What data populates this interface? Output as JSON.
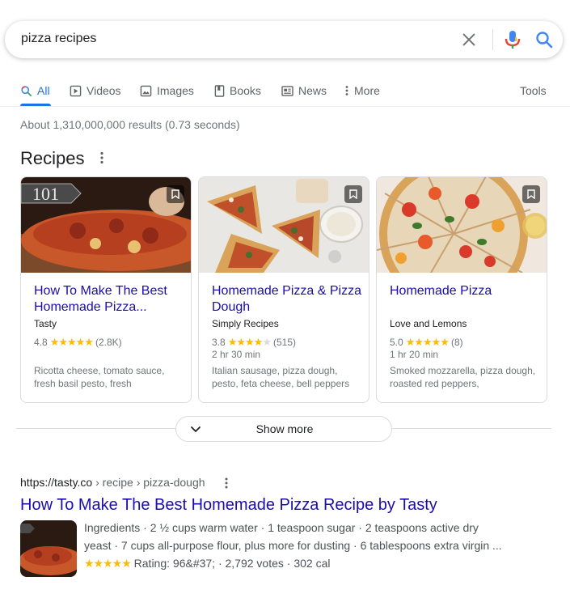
{
  "search": {
    "query": "pizza recipes"
  },
  "tabs": [
    {
      "label": "All",
      "icon": "search-icon",
      "active": true
    },
    {
      "label": "Videos",
      "icon": "play-icon"
    },
    {
      "label": "Images",
      "icon": "image-icon"
    },
    {
      "label": "Books",
      "icon": "book-icon"
    },
    {
      "label": "News",
      "icon": "news-icon"
    },
    {
      "label": "More",
      "icon": "more-vert-icon"
    }
  ],
  "tools_label": "Tools",
  "result_stats": "About 1,310,000,000 results (0.73 seconds)",
  "recipes": {
    "title": "Recipes",
    "cards": [
      {
        "title": "How To Make The Best Homemade Pizza...",
        "source": "Tasty",
        "rating": "4.8",
        "stars": "★★★★★",
        "reviews": "(2.8K)",
        "time": "",
        "ingredients": "Ricotta cheese, tomato sauce, fresh basil pesto, fresh",
        "badge": "101"
      },
      {
        "title": "Homemade Pizza & Pizza Dough",
        "source": "Simply Recipes",
        "rating": "3.8",
        "stars": "★★★★",
        "stars_off": "★",
        "reviews": "(515)",
        "time": "2 hr 30 min",
        "ingredients": "Italian sausage, pizza dough, pesto, feta cheese, bell peppers"
      },
      {
        "title": "Homemade Pizza",
        "source": "Love and Lemons",
        "rating": "5.0",
        "stars": "★★★★★",
        "reviews": "(8)",
        "time": "1 hr 20 min",
        "ingredients": "Smoked mozzarella, pizza dough, roasted red peppers,"
      }
    ],
    "show_more": "Show more"
  },
  "result": {
    "site": "https://tasty.co",
    "path": " › recipe › pizza-dough",
    "title": "How To Make The Best Homemade Pizza Recipe by Tasty",
    "snippet_line1": "Ingredients · 2 ½ cups warm water · 1 teaspoon sugar · 2 teaspoons active dry",
    "snippet_line2": "yeast · 7 cups all-purpose flour, plus more for dusting · 6 tablespoons extra virgin ...",
    "stars": "★★★★★",
    "rating_text": " Rating: 96&#37; · 2,792 votes · 302 cal"
  },
  "colors": {
    "link": "#1a0dab",
    "accent": "#1a73e8",
    "star": "#fbbc04"
  }
}
